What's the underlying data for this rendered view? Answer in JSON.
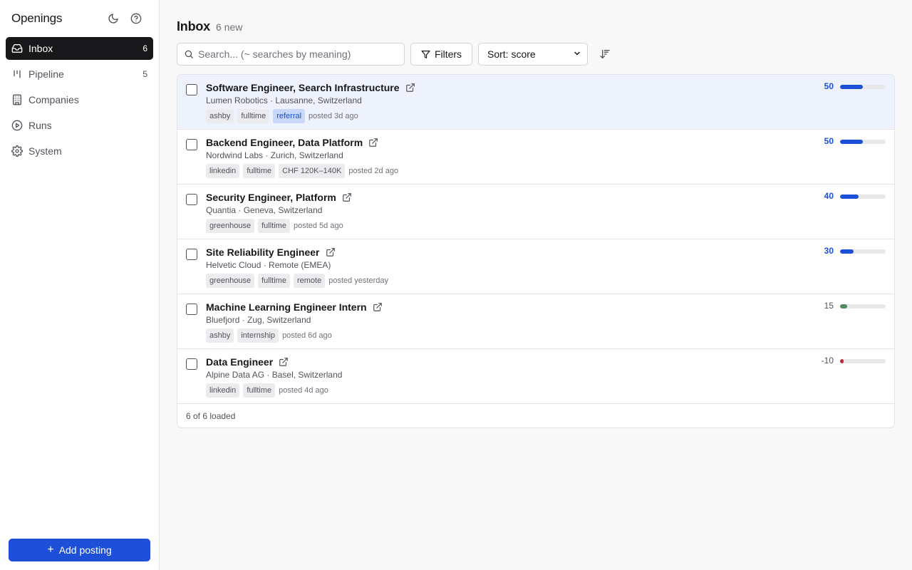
{
  "sidebar": {
    "brand": "Openings",
    "items": [
      {
        "label": "Inbox",
        "count": "6",
        "icon": "inbox-icon",
        "active": true
      },
      {
        "label": "Pipeline",
        "count": "5",
        "icon": "pipeline-icon",
        "active": false
      },
      {
        "label": "Companies",
        "count": "",
        "icon": "building-icon",
        "active": false
      },
      {
        "label": "Runs",
        "count": "",
        "icon": "play-circle-icon",
        "active": false
      },
      {
        "label": "System",
        "count": "",
        "icon": "gear-icon",
        "active": false
      }
    ],
    "add_label": "Add posting"
  },
  "header": {
    "title": "Inbox",
    "subtitle": "6 new"
  },
  "toolbar": {
    "search_placeholder": "Search... (~ searches by meaning)",
    "filters_label": "Filters",
    "sort_label": "Sort: score"
  },
  "postings": [
    {
      "title": "Software Engineer, Search Infrastructure",
      "company": "Lumen Robotics",
      "location": "Lausanne, Switzerland",
      "tags": [
        "ashby",
        "fulltime",
        "referral"
      ],
      "highlight_tag": "referral",
      "posted": "posted 3d ago",
      "score": "50",
      "score_value": 50,
      "selected": true
    },
    {
      "title": "Backend Engineer, Data Platform",
      "company": "Nordwind Labs",
      "location": "Zurich, Switzerland",
      "tags": [
        "linkedin",
        "fulltime",
        "CHF 120K–140K"
      ],
      "highlight_tag": "",
      "posted": "posted 2d ago",
      "score": "50",
      "score_value": 50,
      "selected": false
    },
    {
      "title": "Security Engineer, Platform",
      "company": "Quantia",
      "location": "Geneva, Switzerland",
      "tags": [
        "greenhouse",
        "fulltime"
      ],
      "highlight_tag": "",
      "posted": "posted 5d ago",
      "score": "40",
      "score_value": 40,
      "selected": false
    },
    {
      "title": "Site Reliability Engineer",
      "company": "Helvetic Cloud",
      "location": "Remote (EMEA)",
      "tags": [
        "greenhouse",
        "fulltime",
        "remote"
      ],
      "highlight_tag": "",
      "posted": "posted yesterday",
      "score": "30",
      "score_value": 30,
      "selected": false
    },
    {
      "title": "Machine Learning Engineer Intern",
      "company": "Bluefjord",
      "location": "Zug, Switzerland",
      "tags": [
        "ashby",
        "internship"
      ],
      "highlight_tag": "",
      "posted": "posted 6d ago",
      "score": "15",
      "score_value": 15,
      "selected": false
    },
    {
      "title": "Data Engineer",
      "company": "Alpine Data AG",
      "location": "Basel, Switzerland",
      "tags": [
        "linkedin",
        "fulltime"
      ],
      "highlight_tag": "",
      "posted": "posted 4d ago",
      "score": "-10",
      "score_value": -10,
      "selected": false
    }
  ],
  "list_footer": "6 of 6 loaded",
  "colors": {
    "accent": "#1d4fd8",
    "score_high": "#1d4fd8",
    "score_low": "#4f8a5f",
    "score_negative": "#c0283d"
  }
}
